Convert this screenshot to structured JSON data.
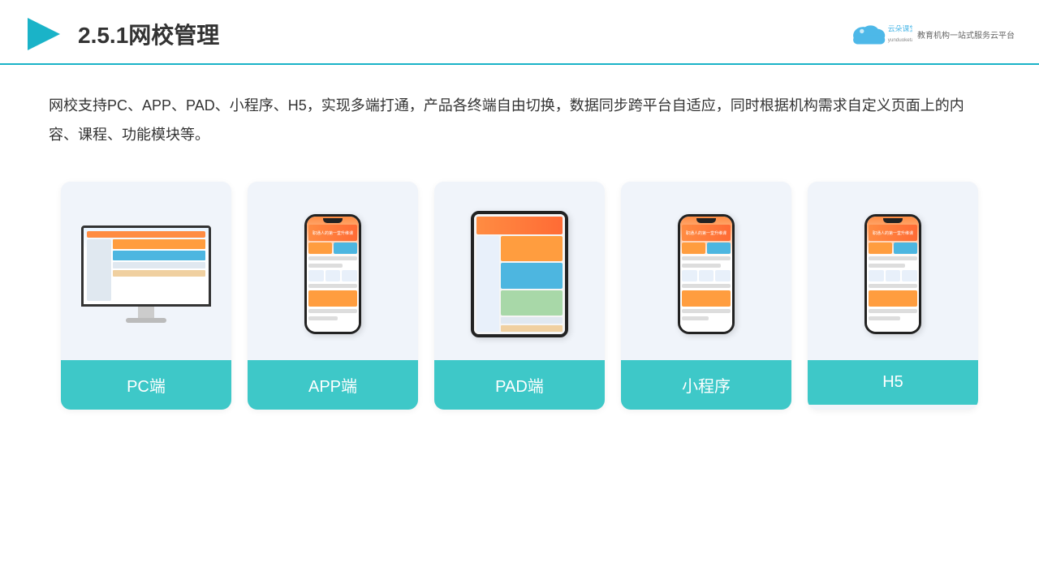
{
  "header": {
    "title": "2.5.1网校管理",
    "logo_name": "云朵课堂",
    "logo_url": "yunduoketang.com",
    "logo_tagline": "教育机构一站式服务云平台"
  },
  "description": {
    "text": "网校支持PC、APP、PAD、小程序、H5，实现多端打通，产品各终端自由切换，数据同步跨平台自适应，同时根据机构需求自定义页面上的内容、课程、功能模块等。"
  },
  "cards": [
    {
      "id": "pc",
      "label": "PC端"
    },
    {
      "id": "app",
      "label": "APP端"
    },
    {
      "id": "pad",
      "label": "PAD端"
    },
    {
      "id": "miniprogram",
      "label": "小程序"
    },
    {
      "id": "h5",
      "label": "H5"
    }
  ]
}
